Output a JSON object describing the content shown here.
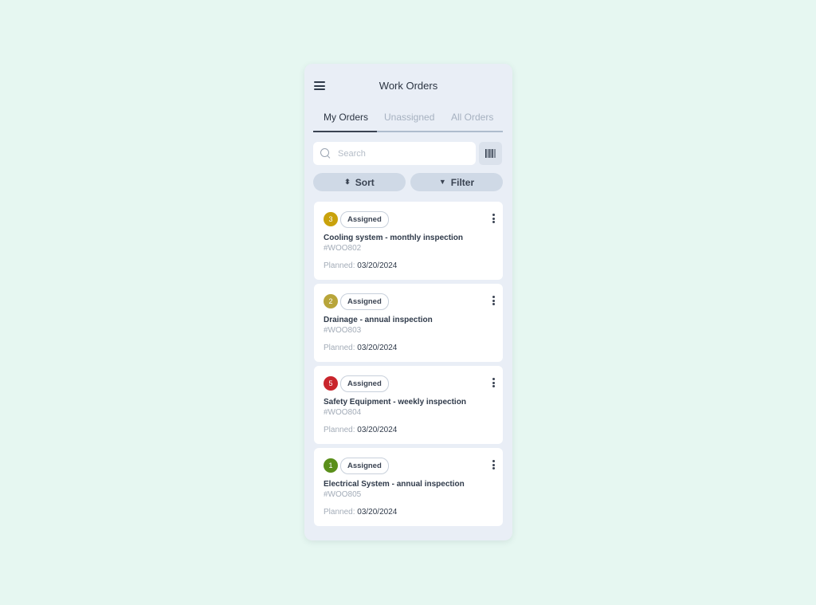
{
  "header": {
    "title": "Work Orders",
    "menu_icon": "hamburger-menu-icon"
  },
  "tabs": [
    {
      "label": "My Orders",
      "active": true
    },
    {
      "label": "Unassigned",
      "active": false
    },
    {
      "label": "All Orders",
      "active": false
    }
  ],
  "search": {
    "placeholder": "Search",
    "value": "",
    "icon": "search-icon",
    "barcode_icon": "barcode-icon"
  },
  "actions": {
    "sort_label": "Sort",
    "sort_icon": "⬍",
    "filter_label": "Filter",
    "filter_icon": "▼"
  },
  "work_orders": [
    {
      "priority": "3",
      "priority_color": "#c9a20c",
      "status": "Assigned",
      "title": "Cooling system - monthly inspection",
      "id": "#WOO802",
      "planned_label": "Planned:",
      "planned_date": "03/20/2024"
    },
    {
      "priority": "2",
      "priority_color": "#b8a53a",
      "status": "Assigned",
      "title": "Drainage - annual inspection",
      "id": "#WOO803",
      "planned_label": "Planned:",
      "planned_date": "03/20/2024"
    },
    {
      "priority": "5",
      "priority_color": "#c9252c",
      "status": "Assigned",
      "title": "Safety Equipment - weekly inspection",
      "id": "#WOO804",
      "planned_label": "Planned:",
      "planned_date": "03/20/2024"
    },
    {
      "priority": "1",
      "priority_color": "#5a8f1a",
      "status": "Assigned",
      "title": "Electrical System - annual inspection",
      "id": "#WOO805",
      "planned_label": "Planned:",
      "planned_date": "03/20/2024"
    }
  ]
}
